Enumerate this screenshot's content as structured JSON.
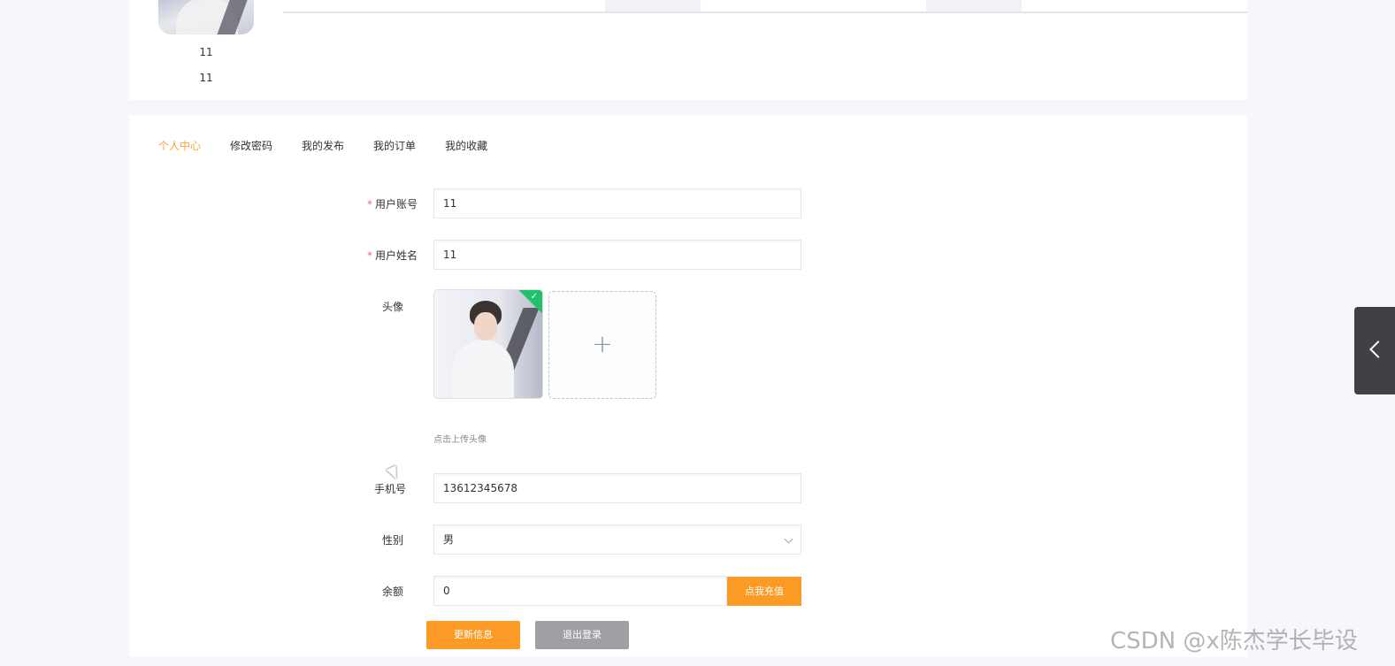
{
  "profile": {
    "name_line1": "11",
    "name_line2": "11"
  },
  "nav": {
    "tabs": [
      {
        "label": "个人中心",
        "active": true
      },
      {
        "label": "修改密码",
        "active": false
      },
      {
        "label": "我的发布",
        "active": false
      },
      {
        "label": "我的订单",
        "active": false
      },
      {
        "label": "我的收藏",
        "active": false
      }
    ]
  },
  "form": {
    "account": {
      "label": "用户账号",
      "required": "*",
      "value": "11"
    },
    "name": {
      "label": "用户姓名",
      "required": "*",
      "value": "11"
    },
    "avatar": {
      "label": "头像",
      "upload_tip": "点击上传头像",
      "add_icon": "+"
    },
    "phone": {
      "label": "手机号",
      "value": "13612345678"
    },
    "gender": {
      "label": "性别",
      "value": "男"
    },
    "balance": {
      "label": "余额",
      "value": "0",
      "recharge_label": "点我充值"
    }
  },
  "actions": {
    "update_label": "更新信息",
    "logout_label": "退出登录"
  },
  "watermark": "CSDN @x陈杰学长毕设",
  "colors": {
    "accent": "#fb9a24",
    "active_tab": "#f7a43b",
    "required": "#f56c6c",
    "success": "#21c16b",
    "logout": "#a0a0a4"
  },
  "icons": {
    "upload_check": "check-icon",
    "upload_add": "plus-icon",
    "select_arrow": "chevron-down-icon",
    "side_toggle": "chevron-left-icon"
  }
}
